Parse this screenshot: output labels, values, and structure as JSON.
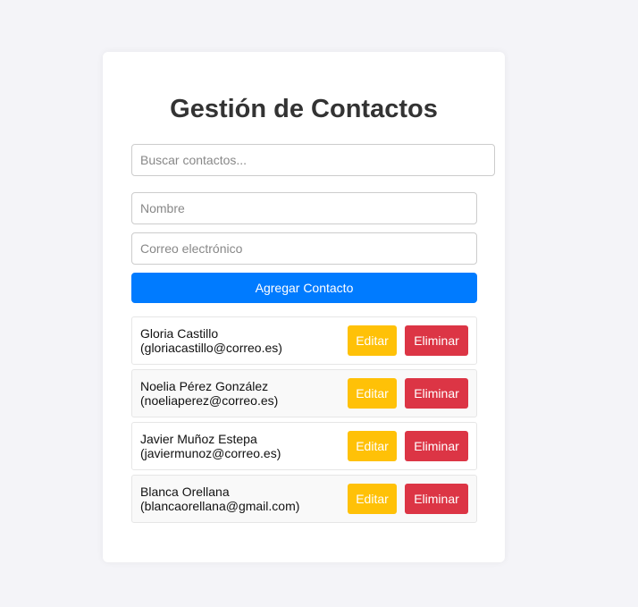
{
  "header": {
    "title": "Gestión de Contactos"
  },
  "search": {
    "placeholder": "Buscar contactos..."
  },
  "form": {
    "name_placeholder": "Nombre",
    "email_placeholder": "Correo electrónico",
    "add_label": "Agregar Contacto"
  },
  "contacts": [
    {
      "name": "Gloria Castillo",
      "email": "(gloriacastillo@correo.es)",
      "edit_label": "Editar",
      "delete_label": "Eliminar"
    },
    {
      "name": "Noelia Pérez González",
      "email": "(noeliaperez@correo.es)",
      "edit_label": "Editar",
      "delete_label": "Eliminar"
    },
    {
      "name": "Javier Muñoz Estepa",
      "email": "(javiermunoz@correo.es)",
      "edit_label": "Editar",
      "delete_label": "Eliminar"
    },
    {
      "name": "Blanca Orellana",
      "email": "(blancaorellana@gmail.com)",
      "edit_label": "Editar",
      "delete_label": "Eliminar"
    }
  ],
  "colors": {
    "primary": "#007bff",
    "edit": "#ffc107",
    "delete": "#dc3545",
    "background": "#f4f4f8"
  }
}
